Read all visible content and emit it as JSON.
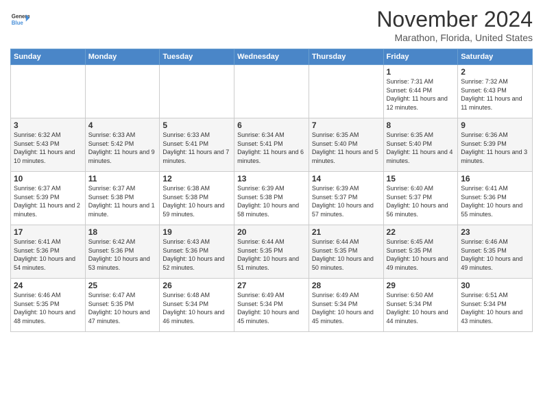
{
  "app": {
    "logo_line1": "General",
    "logo_line2": "Blue"
  },
  "header": {
    "month_title": "November 2024",
    "subtitle": "Marathon, Florida, United States"
  },
  "weekdays": [
    "Sunday",
    "Monday",
    "Tuesday",
    "Wednesday",
    "Thursday",
    "Friday",
    "Saturday"
  ],
  "weeks": [
    [
      {
        "day": "",
        "info": ""
      },
      {
        "day": "",
        "info": ""
      },
      {
        "day": "",
        "info": ""
      },
      {
        "day": "",
        "info": ""
      },
      {
        "day": "",
        "info": ""
      },
      {
        "day": "1",
        "info": "Sunrise: 7:31 AM\nSunset: 6:44 PM\nDaylight: 11 hours and 12 minutes."
      },
      {
        "day": "2",
        "info": "Sunrise: 7:32 AM\nSunset: 6:43 PM\nDaylight: 11 hours and 11 minutes."
      }
    ],
    [
      {
        "day": "3",
        "info": "Sunrise: 6:32 AM\nSunset: 5:43 PM\nDaylight: 11 hours and 10 minutes."
      },
      {
        "day": "4",
        "info": "Sunrise: 6:33 AM\nSunset: 5:42 PM\nDaylight: 11 hours and 9 minutes."
      },
      {
        "day": "5",
        "info": "Sunrise: 6:33 AM\nSunset: 5:41 PM\nDaylight: 11 hours and 7 minutes."
      },
      {
        "day": "6",
        "info": "Sunrise: 6:34 AM\nSunset: 5:41 PM\nDaylight: 11 hours and 6 minutes."
      },
      {
        "day": "7",
        "info": "Sunrise: 6:35 AM\nSunset: 5:40 PM\nDaylight: 11 hours and 5 minutes."
      },
      {
        "day": "8",
        "info": "Sunrise: 6:35 AM\nSunset: 5:40 PM\nDaylight: 11 hours and 4 minutes."
      },
      {
        "day": "9",
        "info": "Sunrise: 6:36 AM\nSunset: 5:39 PM\nDaylight: 11 hours and 3 minutes."
      }
    ],
    [
      {
        "day": "10",
        "info": "Sunrise: 6:37 AM\nSunset: 5:39 PM\nDaylight: 11 hours and 2 minutes."
      },
      {
        "day": "11",
        "info": "Sunrise: 6:37 AM\nSunset: 5:38 PM\nDaylight: 11 hours and 1 minute."
      },
      {
        "day": "12",
        "info": "Sunrise: 6:38 AM\nSunset: 5:38 PM\nDaylight: 10 hours and 59 minutes."
      },
      {
        "day": "13",
        "info": "Sunrise: 6:39 AM\nSunset: 5:38 PM\nDaylight: 10 hours and 58 minutes."
      },
      {
        "day": "14",
        "info": "Sunrise: 6:39 AM\nSunset: 5:37 PM\nDaylight: 10 hours and 57 minutes."
      },
      {
        "day": "15",
        "info": "Sunrise: 6:40 AM\nSunset: 5:37 PM\nDaylight: 10 hours and 56 minutes."
      },
      {
        "day": "16",
        "info": "Sunrise: 6:41 AM\nSunset: 5:36 PM\nDaylight: 10 hours and 55 minutes."
      }
    ],
    [
      {
        "day": "17",
        "info": "Sunrise: 6:41 AM\nSunset: 5:36 PM\nDaylight: 10 hours and 54 minutes."
      },
      {
        "day": "18",
        "info": "Sunrise: 6:42 AM\nSunset: 5:36 PM\nDaylight: 10 hours and 53 minutes."
      },
      {
        "day": "19",
        "info": "Sunrise: 6:43 AM\nSunset: 5:36 PM\nDaylight: 10 hours and 52 minutes."
      },
      {
        "day": "20",
        "info": "Sunrise: 6:44 AM\nSunset: 5:35 PM\nDaylight: 10 hours and 51 minutes."
      },
      {
        "day": "21",
        "info": "Sunrise: 6:44 AM\nSunset: 5:35 PM\nDaylight: 10 hours and 50 minutes."
      },
      {
        "day": "22",
        "info": "Sunrise: 6:45 AM\nSunset: 5:35 PM\nDaylight: 10 hours and 49 minutes."
      },
      {
        "day": "23",
        "info": "Sunrise: 6:46 AM\nSunset: 5:35 PM\nDaylight: 10 hours and 49 minutes."
      }
    ],
    [
      {
        "day": "24",
        "info": "Sunrise: 6:46 AM\nSunset: 5:35 PM\nDaylight: 10 hours and 48 minutes."
      },
      {
        "day": "25",
        "info": "Sunrise: 6:47 AM\nSunset: 5:35 PM\nDaylight: 10 hours and 47 minutes."
      },
      {
        "day": "26",
        "info": "Sunrise: 6:48 AM\nSunset: 5:34 PM\nDaylight: 10 hours and 46 minutes."
      },
      {
        "day": "27",
        "info": "Sunrise: 6:49 AM\nSunset: 5:34 PM\nDaylight: 10 hours and 45 minutes."
      },
      {
        "day": "28",
        "info": "Sunrise: 6:49 AM\nSunset: 5:34 PM\nDaylight: 10 hours and 45 minutes."
      },
      {
        "day": "29",
        "info": "Sunrise: 6:50 AM\nSunset: 5:34 PM\nDaylight: 10 hours and 44 minutes."
      },
      {
        "day": "30",
        "info": "Sunrise: 6:51 AM\nSunset: 5:34 PM\nDaylight: 10 hours and 43 minutes."
      }
    ]
  ]
}
